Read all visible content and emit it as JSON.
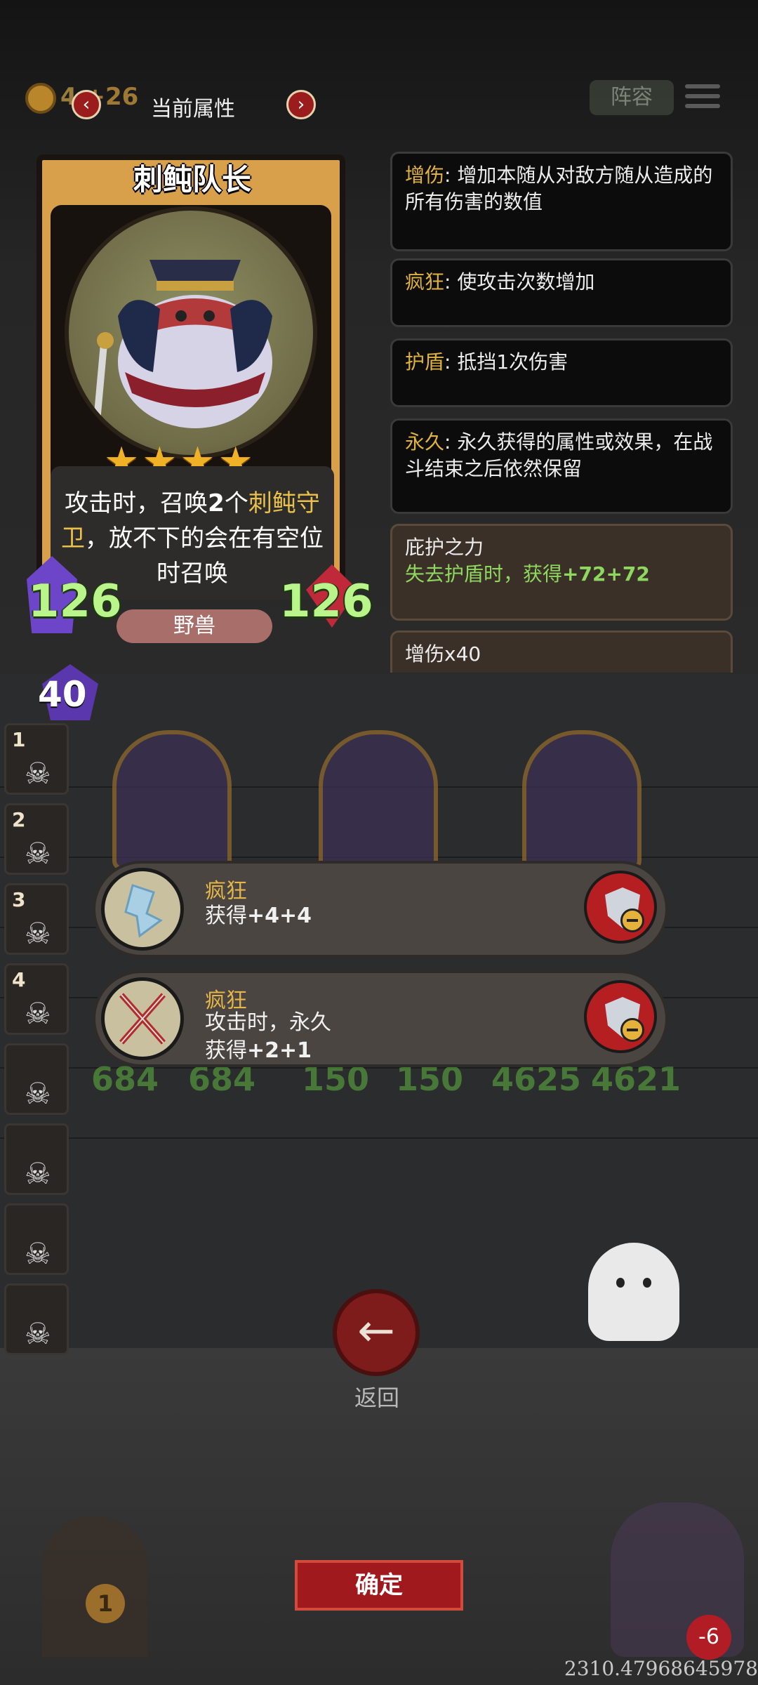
{
  "topbar": {
    "gold": "4",
    "gold_gain": "+26",
    "title": "当前属性",
    "lineup": "阵容"
  },
  "card": {
    "name": "刺鲀队长",
    "stars": 4,
    "desc_1": "攻击时，召唤",
    "desc_count": "2",
    "desc_2": "个",
    "desc_unit": "刺鲀守卫",
    "desc_3": "，放不下的会在有空位时召唤",
    "attack": "126",
    "health": "126",
    "tribe": "野兽"
  },
  "traits": [
    {
      "keyword": "增伤",
      "text": ": 增加本随从对敌方随从造成的所有伤害的数值"
    },
    {
      "keyword": "疯狂",
      "text": ": 使攻击次数增加"
    },
    {
      "keyword": "护盾",
      "text": ": 抵挡1次伤害"
    },
    {
      "keyword": "永久",
      "text": ": 永久获得的属性或效果，在战斗结束之后依然保留"
    }
  ],
  "buff_block": {
    "title": "庇护之力",
    "line_prefix": "失去护盾时，获得",
    "line_value": "+72+72"
  },
  "damage_block": {
    "text": "增伤x40"
  },
  "level": "40",
  "side_slots": [
    "1",
    "2",
    "3",
    "4",
    "",
    "",
    "",
    ""
  ],
  "units": [
    {
      "stats_left": "684",
      "stats_right": "684"
    },
    {
      "stats_left": "150",
      "stats_right": "150"
    },
    {
      "stats_left": "4625",
      "stats_right": "4621"
    }
  ],
  "effects": [
    {
      "title": "疯狂",
      "line1": "获得",
      "line1_value": "+4+4",
      "line2": "",
      "line3": ""
    },
    {
      "title": "疯狂",
      "line1": "攻击时，永久",
      "line1_value": "",
      "line2": "获得",
      "line2_value": "+2+1"
    }
  ],
  "back_label": "返回",
  "confirm_label": "确定",
  "door_count": "1",
  "hero_hp": "-6",
  "footer_code": "2310.47968645978",
  "colors": {
    "keyword": "#e0b23e",
    "green_value": "#8ed85f",
    "stat_green": "#b9f58a",
    "button_red": "#a0191c"
  }
}
